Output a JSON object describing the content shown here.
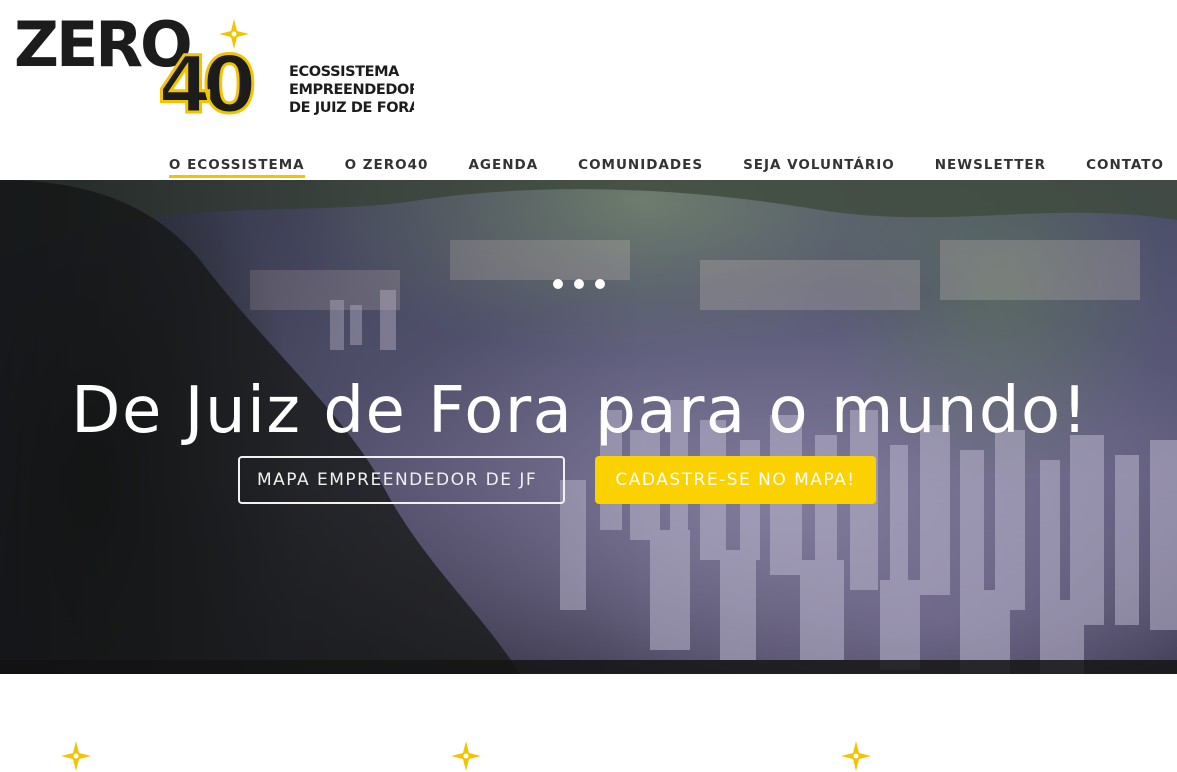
{
  "brand": {
    "name_part": "ZERO",
    "name_digits": "40",
    "tagline": [
      "ECOSSISTEMA",
      "EMPREENDEDOR",
      "DE JUIZ DE FORA"
    ],
    "accent_color": "#f2c400",
    "dark_color": "#1c1c1c"
  },
  "nav": {
    "items": [
      {
        "label": "O ECOSSISTEMA",
        "active": true
      },
      {
        "label": "O ZERO40",
        "active": false
      },
      {
        "label": "AGENDA",
        "active": false
      },
      {
        "label": "COMUNIDADES",
        "active": false
      },
      {
        "label": "SEJA VOLUNTÁRIO",
        "active": false
      },
      {
        "label": "NEWSLETTER",
        "active": false
      },
      {
        "label": "CONTATO",
        "active": false
      }
    ]
  },
  "hero": {
    "title": "De Juiz de Fora para o mundo!",
    "primary_button": "MAPA EMPREENDEDOR DE JF",
    "secondary_button": "CADASTRE-SE NO MAPA!",
    "button_color": "#fbd200"
  },
  "features": {
    "icons": [
      "sparkle-icon",
      "sparkle-icon",
      "sparkle-icon"
    ]
  }
}
